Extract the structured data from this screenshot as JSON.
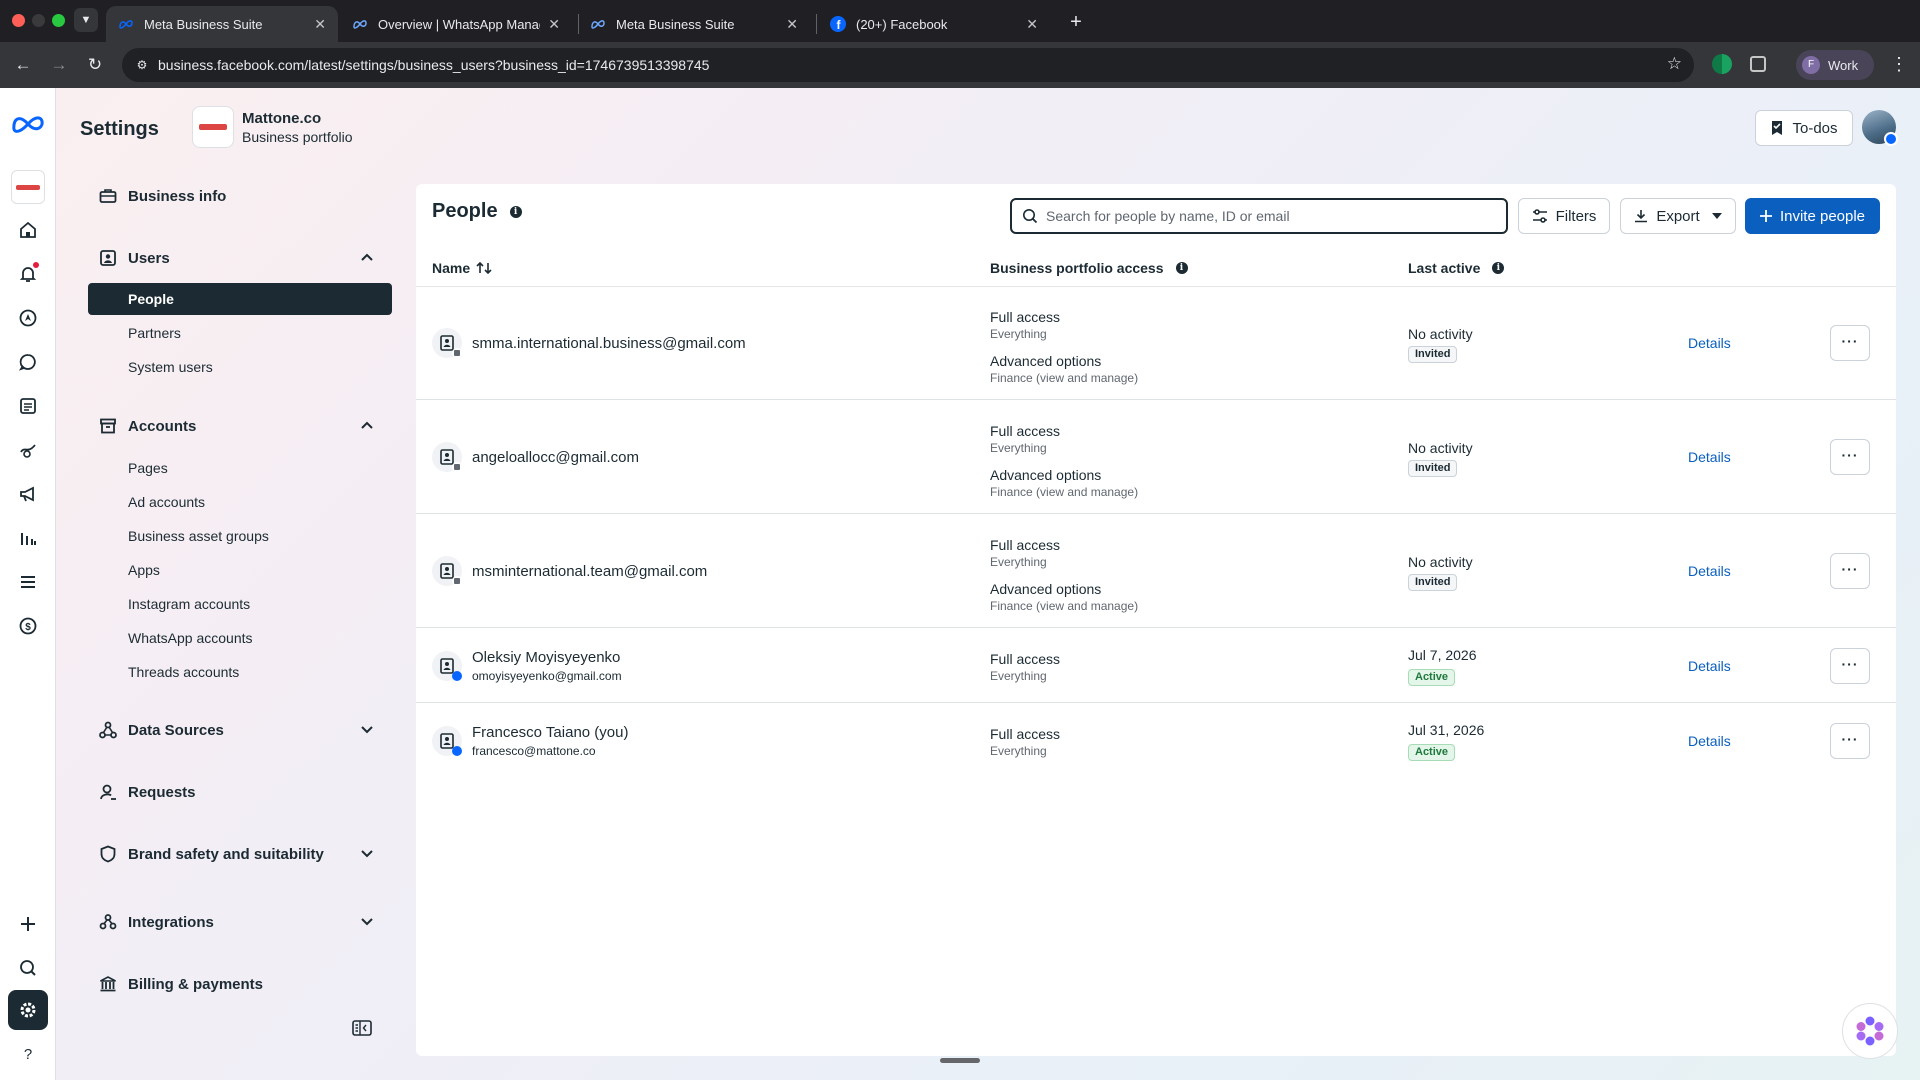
{
  "browser": {
    "tabs": [
      {
        "title": "Meta Business Suite",
        "active": true
      },
      {
        "title": "Overview | WhatsApp Manager",
        "active": false
      },
      {
        "title": "Meta Business Suite",
        "active": false
      },
      {
        "title": "(20+) Facebook",
        "active": false
      }
    ],
    "url": "business.facebook.com/latest/settings/business_users?business_id=1746739513398745",
    "profile_label": "Work",
    "profile_initial": "F"
  },
  "header": {
    "title": "Settings",
    "portfolio_name": "Mattone.co",
    "portfolio_sub": "Business portfolio",
    "todos_label": "To-dos"
  },
  "sidebar": {
    "business_info": "Business info",
    "users": {
      "label": "Users",
      "items": [
        "People",
        "Partners",
        "System users"
      ]
    },
    "accounts": {
      "label": "Accounts",
      "items": [
        "Pages",
        "Ad accounts",
        "Business asset groups",
        "Apps",
        "Instagram accounts",
        "WhatsApp accounts",
        "Threads accounts"
      ]
    },
    "data_sources": "Data Sources",
    "requests": "Requests",
    "brand_safety": "Brand safety and suitability",
    "integrations": "Integrations",
    "billing": "Billing & payments"
  },
  "main": {
    "title": "People",
    "search_placeholder": "Search for people by name, ID or email",
    "filters_label": "Filters",
    "export_label": "Export",
    "invite_label": "Invite people",
    "columns": {
      "name": "Name",
      "access": "Business portfolio access",
      "last_active": "Last active"
    },
    "details_label": "Details",
    "rows": [
      {
        "name": "smma.international.business@gmail.com",
        "email": "",
        "access_title": "Full access",
        "access_sub": "Everything",
        "adv_title": "Advanced options",
        "adv_sub": "Finance (view and manage)",
        "last": "No activity",
        "status": "Invited"
      },
      {
        "name": "angeloallocc@gmail.com",
        "email": "",
        "access_title": "Full access",
        "access_sub": "Everything",
        "adv_title": "Advanced options",
        "adv_sub": "Finance (view and manage)",
        "last": "No activity",
        "status": "Invited"
      },
      {
        "name": "msminternational.team@gmail.com",
        "email": "",
        "access_title": "Full access",
        "access_sub": "Everything",
        "adv_title": "Advanced options",
        "adv_sub": "Finance (view and manage)",
        "last": "No activity",
        "status": "Invited"
      },
      {
        "name": "Oleksiy Moyisyeyenko",
        "email": "omoyisyeyenko@gmail.com",
        "access_title": "Full access",
        "access_sub": "Everything",
        "last": "Jul 7, 2026",
        "status": "Active"
      },
      {
        "name": "Francesco Taiano (you)",
        "email": "francesco@mattone.co",
        "access_title": "Full access",
        "access_sub": "Everything",
        "last": "Jul 31, 2026",
        "status": "Active"
      }
    ]
  },
  "colors": {
    "accent": "#0a5fbf",
    "dark": "#1c2b33",
    "active_badge": "#1e7a3d",
    "notification": "#e41e3f"
  }
}
